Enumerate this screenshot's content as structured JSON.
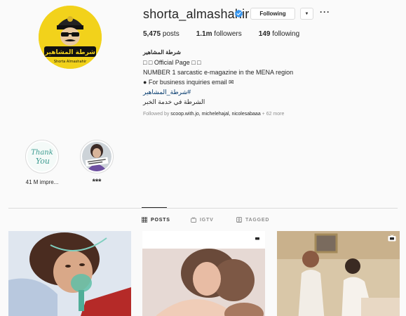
{
  "profile": {
    "username": "shorta_almashahir",
    "verified": true,
    "following_label": "Following",
    "avatar_text": "شرطة المشاهير",
    "avatar_subtext": "Shorta Almashahir",
    "accent_color": "#f2d21b"
  },
  "stats": {
    "posts_count": "5,475",
    "posts_label": "posts",
    "followers_count": "1.1m",
    "followers_label": "followers",
    "following_count": "149",
    "following_label": "following"
  },
  "bio": {
    "full_name": "شرطة المشاهير",
    "lines": [
      "□ □ Official Page □ □",
      "NUMBER 1 sarcastic e-magazine in the MENA region",
      "● For business inquiries email ✉"
    ],
    "hashtag": "#شرطة_المشاهير",
    "tagline": "الشرطة في خدمة الخبر",
    "followed_by_prefix": "Followed by ",
    "followed_by_names": "scoop.with.jo, michelehajal, nicolesabaaa",
    "followed_by_suffix": " + 62 more"
  },
  "highlights": [
    {
      "label": "41 M impre...",
      "icon": "thank-you-image"
    },
    {
      "label": "***",
      "icon": "highlight-image"
    }
  ],
  "tabs": [
    {
      "label": "POSTS",
      "icon": "grid-icon",
      "active": true
    },
    {
      "label": "IGTV",
      "icon": "igtv-icon",
      "active": false
    },
    {
      "label": "TAGGED",
      "icon": "tag-icon",
      "active": false
    }
  ],
  "posts": [
    {
      "type": "photo"
    },
    {
      "type": "igtv"
    },
    {
      "type": "igtv"
    }
  ]
}
